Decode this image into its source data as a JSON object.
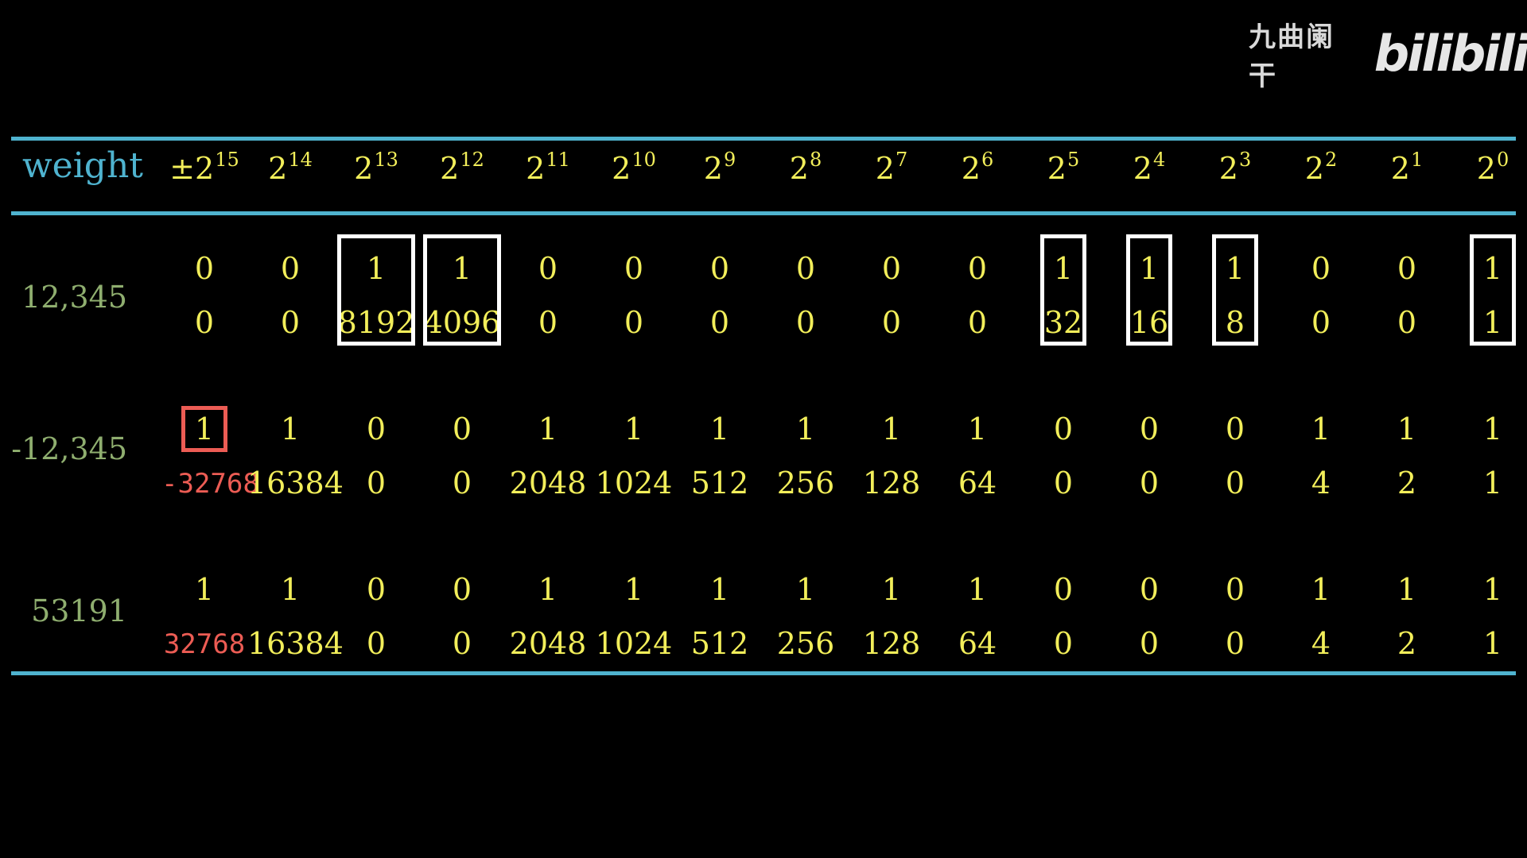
{
  "watermark": {
    "text": "九曲阑干",
    "logo": "bilibili"
  },
  "header": {
    "weight_label": "weight",
    "columns": [
      {
        "base": "±2",
        "exp": "15"
      },
      {
        "base": "2",
        "exp": "14"
      },
      {
        "base": "2",
        "exp": "13"
      },
      {
        "base": "2",
        "exp": "12"
      },
      {
        "base": "2",
        "exp": "11"
      },
      {
        "base": "2",
        "exp": "10"
      },
      {
        "base": "2",
        "exp": "9"
      },
      {
        "base": "2",
        "exp": "8"
      },
      {
        "base": "2",
        "exp": "7"
      },
      {
        "base": "2",
        "exp": "6"
      },
      {
        "base": "2",
        "exp": "5"
      },
      {
        "base": "2",
        "exp": "4"
      },
      {
        "base": "2",
        "exp": "3"
      },
      {
        "base": "2",
        "exp": "2"
      },
      {
        "base": "2",
        "exp": "1"
      },
      {
        "base": "2",
        "exp": "0"
      }
    ]
  },
  "rows": [
    {
      "label": "12,345",
      "bits": [
        "0",
        "0",
        "1",
        "1",
        "0",
        "0",
        "0",
        "0",
        "0",
        "0",
        "1",
        "1",
        "1",
        "0",
        "0",
        "1"
      ],
      "values": [
        "0",
        "0",
        "8192",
        "4096",
        "0",
        "0",
        "0",
        "0",
        "0",
        "0",
        "32",
        "16",
        "8",
        "0",
        "0",
        "1"
      ]
    },
    {
      "label": "-12,345",
      "bits": [
        "1",
        "1",
        "0",
        "0",
        "1",
        "1",
        "1",
        "1",
        "1",
        "1",
        "0",
        "0",
        "0",
        "1",
        "1",
        "1"
      ],
      "values": [
        "-32768",
        "16384",
        "0",
        "0",
        "2048",
        "1024",
        "512",
        "256",
        "128",
        "64",
        "0",
        "0",
        "0",
        "4",
        "2",
        "1"
      ]
    },
    {
      "label": "53191",
      "bits": [
        "1",
        "1",
        "0",
        "0",
        "1",
        "1",
        "1",
        "1",
        "1",
        "1",
        "0",
        "0",
        "0",
        "1",
        "1",
        "1"
      ],
      "values": [
        "32768",
        "16384",
        "0",
        "0",
        "2048",
        "1024",
        "512",
        "256",
        "128",
        "64",
        "0",
        "0",
        "0",
        "4",
        "2",
        "1"
      ]
    }
  ],
  "colors": {
    "rule": "#4fb3cf",
    "digits": "#f2ee5a",
    "labels": "#8fae6f",
    "highlight": "#ec5c54",
    "box": "#ffffff"
  }
}
